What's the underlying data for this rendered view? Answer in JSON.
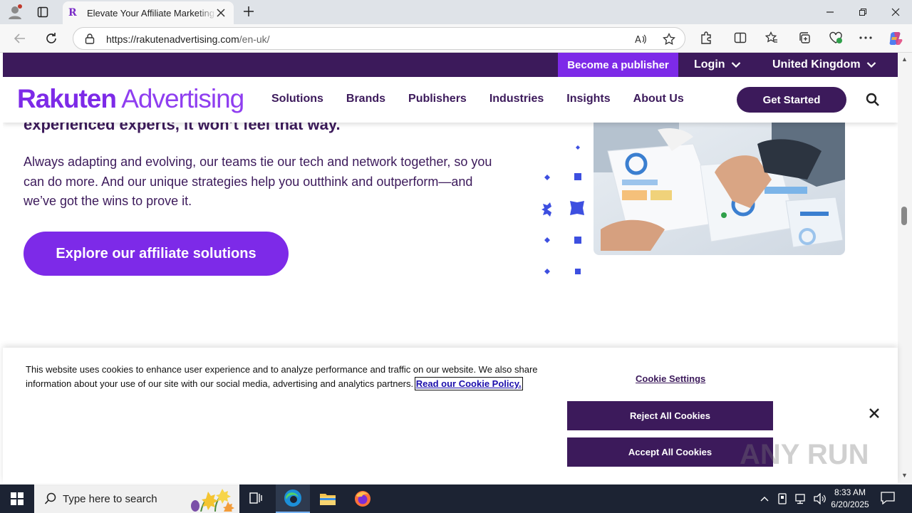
{
  "browser": {
    "tab_title": "Elevate Your Affiliate Marketing with Rakuten Advertising",
    "tab_favicon": "R",
    "url_domain": "https://rakutenadvertising.com",
    "url_path": "/en-uk/"
  },
  "site": {
    "utility": {
      "become_publisher": "Become a publisher",
      "login": "Login",
      "region": "United Kingdom"
    },
    "logo": {
      "bold": "Rakuten",
      "light": " Advertising"
    },
    "nav": [
      "Solutions",
      "Brands",
      "Publishers",
      "Industries",
      "Insights",
      "About Us"
    ],
    "get_started": "Get Started",
    "hero": {
      "heading": "experienced experts, it won’t feel that way.",
      "body": "Always adapting and evolving, our teams tie our tech and network together, so you can do more. And our unique strategies help you outthink and outperform—and we’ve got the wins to prove it.",
      "cta": "Explore our affiliate solutions"
    },
    "colors": {
      "purple_dark": "#3c1a5b",
      "purple_bright": "#7d2ae8",
      "star_blue": "#3d4fe0"
    }
  },
  "cookie": {
    "text": "This website uses cookies to enhance user experience and to analyze performance and traffic on our website. We also share information about your use of our site with our social media, advertising and analytics partners.",
    "link": "Read our Cookie Policy.",
    "settings": "Cookie Settings",
    "reject": "Reject All Cookies",
    "accept": "Accept All Cookies"
  },
  "watermark": "ANY RUN",
  "taskbar": {
    "search_placeholder": "Type here to search",
    "time": "8:33 AM",
    "date": "6/20/2025"
  }
}
